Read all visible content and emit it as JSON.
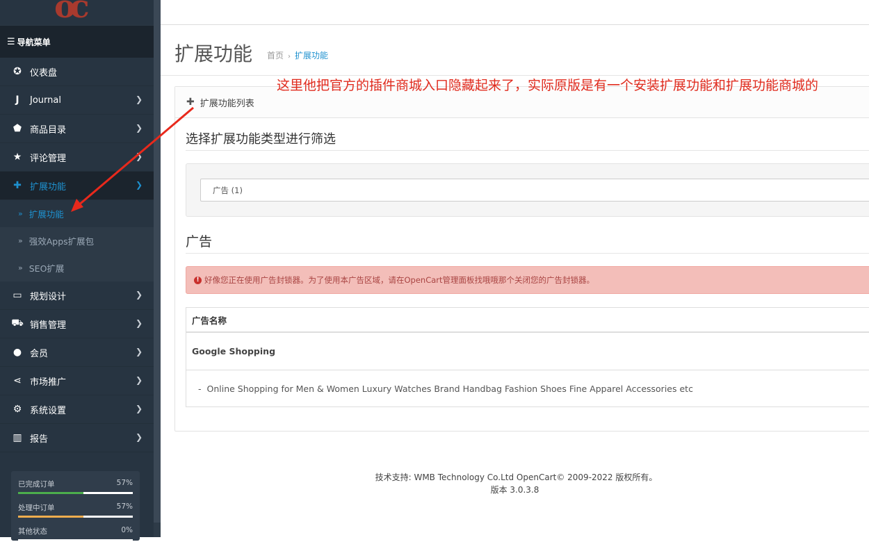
{
  "sidebar": {
    "logo_text": "oc",
    "nav_header": "导航菜单",
    "items": [
      {
        "label": "仪表盘",
        "icon": "dashboard-icon",
        "glyph": "✪",
        "has_chevron": false
      },
      {
        "label": "Journal",
        "icon": "journal-j-icon",
        "glyph": "J",
        "has_chevron": true
      },
      {
        "label": "商品目录",
        "icon": "tags-icon",
        "glyph": "⬟",
        "has_chevron": true
      },
      {
        "label": "评论管理",
        "icon": "star-icon",
        "glyph": "★",
        "has_chevron": true
      },
      {
        "label": "扩展功能",
        "icon": "puzzle-icon",
        "glyph": "✚",
        "has_chevron": true,
        "active": true
      }
    ],
    "submenu": [
      {
        "label": "扩展功能",
        "current": true
      },
      {
        "label": "强效Apps扩展包"
      },
      {
        "label": "SEO扩展"
      }
    ],
    "items_after": [
      {
        "label": "规划设计",
        "icon": "desktop-icon",
        "glyph": "▭"
      },
      {
        "label": "销售管理",
        "icon": "cart-icon",
        "glyph": "⛟"
      },
      {
        "label": "会员",
        "icon": "user-icon",
        "glyph": "●"
      },
      {
        "label": "市场推广",
        "icon": "share-icon",
        "glyph": "⋖"
      },
      {
        "label": "系统设置",
        "icon": "cog-icon",
        "glyph": "⚙"
      },
      {
        "label": "报告",
        "icon": "bar-chart-icon",
        "glyph": "▥"
      }
    ],
    "stats": [
      {
        "label": "已完成订单",
        "percent": "57%",
        "value": 0.57,
        "color": "#4cae4c"
      },
      {
        "label": "处理中订单",
        "percent": "57%",
        "value": 0.57,
        "color": "#f0ad4e"
      },
      {
        "label": "其他状态",
        "percent": "0%",
        "value": 0,
        "color": "#d9534f"
      }
    ]
  },
  "header": {
    "title": "扩展功能",
    "breadcrumb_home": "首页",
    "breadcrumb_current": "扩展功能"
  },
  "panel": {
    "heading": "扩展功能列表",
    "filter_title": "选择扩展功能类型进行筛选",
    "select_value": "广告 (1)",
    "section_title": "广告",
    "alert": "好像您正在使用广告封锁器。为了使用本广告区域，请在OpenCart管理面板找哦哦那个关闭您的广告封锁器。",
    "table_header": "广告名称",
    "row_title": "Google Shopping",
    "row_desc": "Online Shopping for Men & Women Luxury Watches Brand Handbag Fashion Shoes Fine Apparel Accessories etc"
  },
  "footer": {
    "line1": "技术支持: WMB Technology Co.Ltd  OpenCart© 2009-2022 版权所有。",
    "line2": "版本 3.0.3.8"
  },
  "annotation": {
    "text": "这里他把官方的插件商城入口隐藏起来了，实际原版是有一个安装扩展功能和扩展功能商城的",
    "color": "#e02b1e"
  }
}
